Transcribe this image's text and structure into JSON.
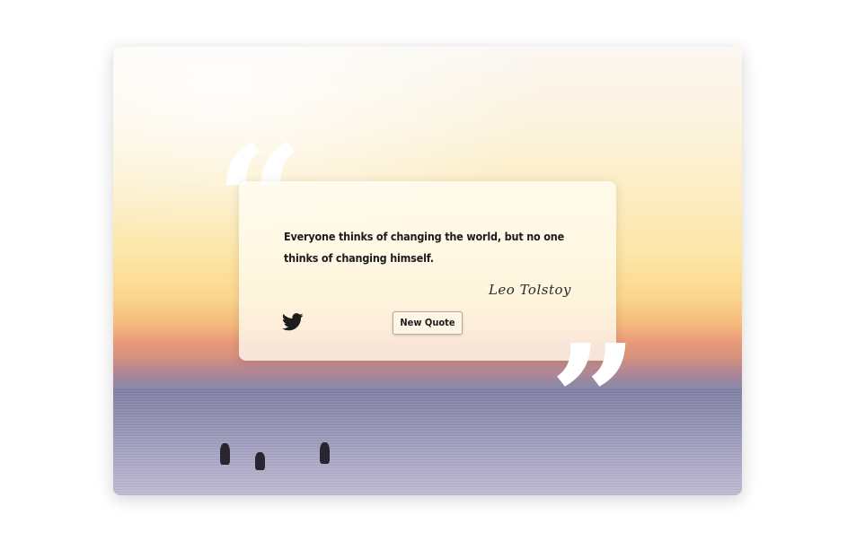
{
  "quote": {
    "text": "Everyone thinks of changing the world, but no one thinks of changing himself.",
    "author": "Leo Tolstoy"
  },
  "buttons": {
    "new_quote_label": "New Quote",
    "tweet_icon": "twitter-icon"
  },
  "decorations": {
    "open_quote_glyph": "“",
    "close_quote_glyph": "”",
    "background_scene": "sunset-sea-surfers"
  },
  "colors": {
    "quote_mark": "#ffffff",
    "text": "#1c1c1c",
    "card_bg": "#fffcf4"
  }
}
